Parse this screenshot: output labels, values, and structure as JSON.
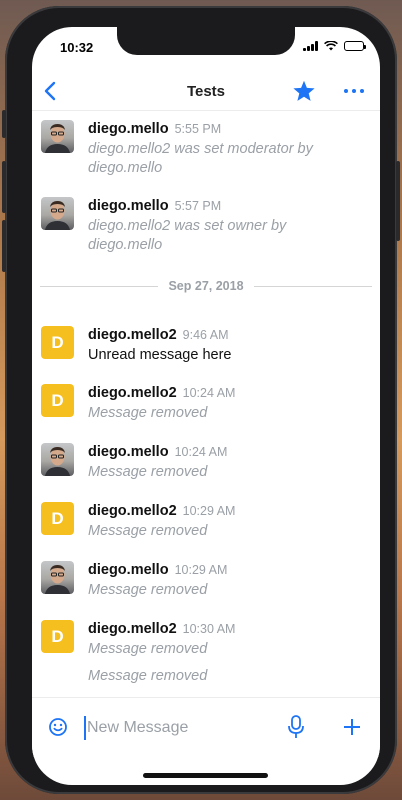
{
  "status_bar": {
    "time": "10:32"
  },
  "header": {
    "title": "Tests",
    "back_icon": "chevron-left-icon",
    "star_icon": "star-icon",
    "more_icon": "more-horizontal-icon"
  },
  "colors": {
    "accent": "#1d74f5",
    "avatar_letter_bg": "#f5bf1f"
  },
  "messages": [
    {
      "username": "diego.mello",
      "time": "5:55 PM",
      "avatar": "photo",
      "body": "diego.mello2 was set moderator by diego.mello",
      "type": "system"
    },
    {
      "username": "diego.mello",
      "time": "5:57 PM",
      "avatar": "photo",
      "body": "diego.mello2 was set owner by diego.mello",
      "type": "system"
    },
    {
      "username": "diego.mello2",
      "time": "9:46 AM",
      "avatar": "D",
      "body": "Unread message here",
      "type": "normal"
    },
    {
      "username": "diego.mello2",
      "time": "10:24 AM",
      "avatar": "D",
      "body": "Message removed",
      "type": "removed"
    },
    {
      "username": "diego.mello",
      "time": "10:24 AM",
      "avatar": "photo",
      "body": "Message removed",
      "type": "removed"
    },
    {
      "username": "diego.mello2",
      "time": "10:29 AM",
      "avatar": "D",
      "body": "Message removed",
      "type": "removed"
    },
    {
      "username": "diego.mello",
      "time": "10:29 AM",
      "avatar": "photo",
      "body": "Message removed",
      "type": "removed"
    },
    {
      "username": "diego.mello2",
      "time": "10:30 AM",
      "avatar": "D",
      "body": "Message removed",
      "type": "removed"
    }
  ],
  "continuation_messages": [
    {
      "body": "Message removed"
    }
  ],
  "date_separator": {
    "label": "Sep 27, 2018"
  },
  "composer": {
    "placeholder": "New Message",
    "emoji_icon": "emoji-icon",
    "mic_icon": "microphone-icon",
    "add_icon": "plus-icon"
  }
}
